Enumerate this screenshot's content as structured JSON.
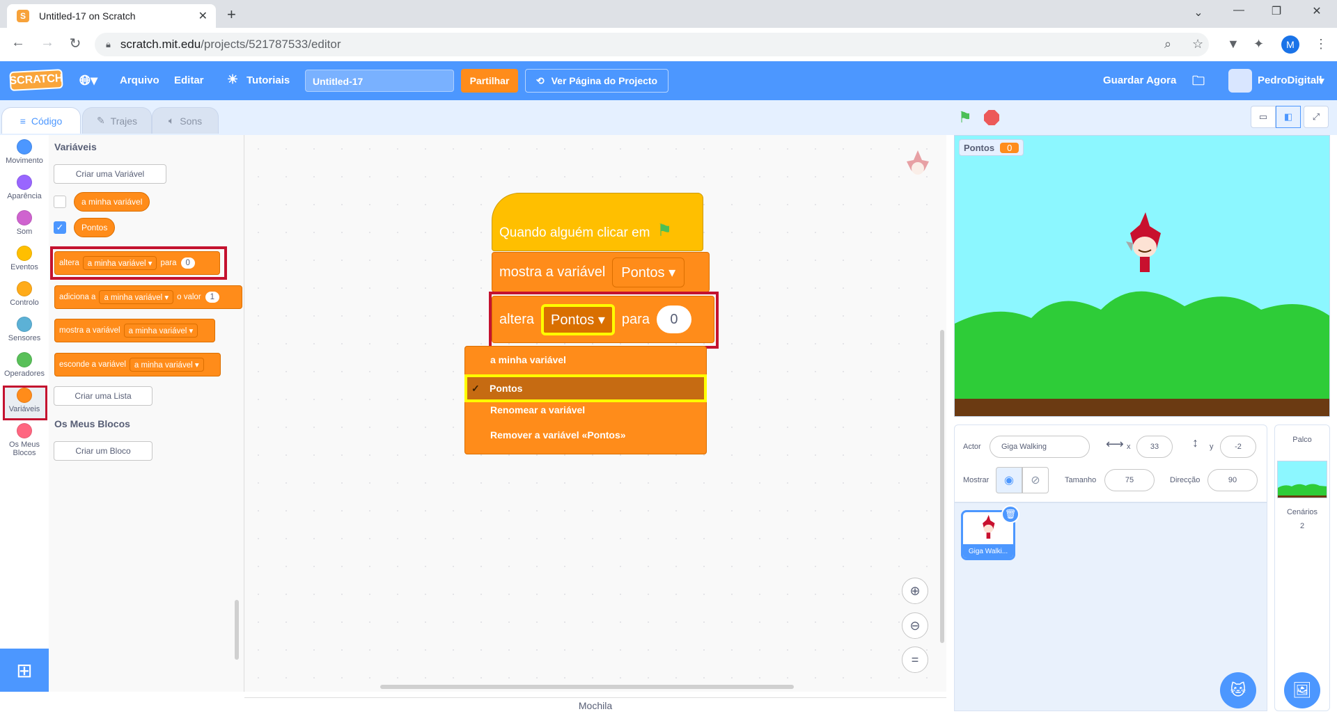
{
  "browser": {
    "tab_title": "Untitled-17 on Scratch",
    "url_domain": "scratch.mit.edu",
    "url_path": "/projects/521787533/editor",
    "profile_initial": "M"
  },
  "menubar": {
    "logo": "SCRATCH",
    "file": "Arquivo",
    "edit": "Editar",
    "tutorials": "Tutoriais",
    "project_title": "Untitled-17",
    "share": "Partilhar",
    "see_project": "Ver Página do Projecto",
    "save_now": "Guardar Agora",
    "username": "PedroDigitall"
  },
  "editor_tabs": {
    "code": "Código",
    "costumes": "Trajes",
    "sounds": "Sons"
  },
  "categories": [
    {
      "label": "Movimento",
      "color": "#4c97ff"
    },
    {
      "label": "Aparência",
      "color": "#9966ff"
    },
    {
      "label": "Som",
      "color": "#cf63cf"
    },
    {
      "label": "Eventos",
      "color": "#ffbf00"
    },
    {
      "label": "Controlo",
      "color": "#ffab19"
    },
    {
      "label": "Sensores",
      "color": "#5cb1d6"
    },
    {
      "label": "Operadores",
      "color": "#59c059"
    },
    {
      "label": "Variáveis",
      "color": "#ff8c1a"
    },
    {
      "label": "Os Meus Blocos",
      "color": "#ff6680"
    }
  ],
  "palette": {
    "section_title": "Variáveis",
    "make_variable": "Criar uma Variável",
    "var1": "a minha variável",
    "var2": "Pontos",
    "block_set": {
      "text": "altera",
      "dropdown": "a minha variável",
      "to": "para",
      "value": "0"
    },
    "block_change": {
      "text": "adiciona a",
      "dropdown": "a minha variável",
      "by": "o valor",
      "value": "1"
    },
    "block_show": {
      "text": "mostra a variável",
      "dropdown": "a minha variável"
    },
    "block_hide": {
      "text": "esconde a variável",
      "dropdown": "a minha variável"
    },
    "make_list": "Criar uma Lista",
    "myblocks_title": "Os Meus Blocos",
    "make_block": "Criar um Bloco"
  },
  "script": {
    "hat": "Quando alguém clicar em",
    "show_var": {
      "text": "mostra a variável",
      "dropdown": "Pontos"
    },
    "set_var": {
      "text": "altera",
      "dropdown": "Pontos",
      "to": "para",
      "value": "0"
    }
  },
  "dropdown_menu": {
    "items": [
      "a minha variável",
      "Pontos",
      "Renomear a variável",
      "Remover a variável «Pontos»"
    ],
    "checkmark": "✓"
  },
  "stage": {
    "monitor_label": "Pontos",
    "monitor_value": "0"
  },
  "sprite_info": {
    "sprite_label": "Actor",
    "sprite_name": "Giga Walking",
    "x_label": "x",
    "x_value": "33",
    "y_label": "y",
    "y_value": "-2",
    "show_label": "Mostrar",
    "size_label": "Tamanho",
    "size_value": "75",
    "direction_label": "Direcção",
    "direction_value": "90"
  },
  "sprite_list": [
    {
      "name": "Giga Walki..."
    }
  ],
  "stage_panel": {
    "title": "Palco",
    "backdrops_label": "Cenários",
    "backdrops_count": "2"
  },
  "backpack": "Mochila"
}
